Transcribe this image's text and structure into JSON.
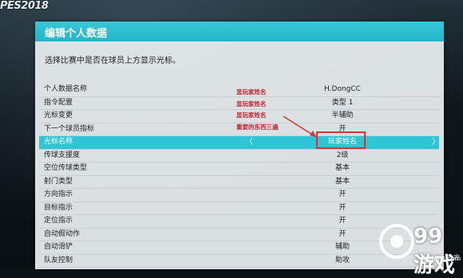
{
  "logo": "PES2018",
  "panel": {
    "title": "编辑个人数据",
    "description": "选择比赛中是否在球员上方显示光标。"
  },
  "rows": [
    {
      "label": "个人数据名称",
      "value": "H.DongCC"
    },
    {
      "label": "指令配置",
      "value": "类型 1"
    },
    {
      "label": "光标变更",
      "value": "半辅助"
    },
    {
      "label": "下一个球员指标",
      "value": "开"
    },
    {
      "label": "光标名称",
      "value": "玩家姓名",
      "selected": true
    },
    {
      "label": "传球支援度",
      "value": "2级"
    },
    {
      "label": "空位传球类型",
      "value": "基本"
    },
    {
      "label": "射门类型",
      "value": "基本"
    },
    {
      "label": "方向指示",
      "value": "开"
    },
    {
      "label": "目标指示",
      "value": "开"
    },
    {
      "label": "定位指示",
      "value": "开"
    },
    {
      "label": "自动假动作",
      "value": "开"
    },
    {
      "label": "自动滑铲",
      "value": "辅助"
    },
    {
      "label": "队友控制",
      "value": "助攻"
    }
  ],
  "hints": [
    "显玩家姓名",
    "显玩家姓名",
    "显玩家姓名",
    "重要的东西三遍"
  ],
  "arrows": {
    "left": "〈",
    "right": "〉"
  },
  "footer_right": "助攻",
  "watermark": {
    "logo": "99游戏",
    "url": "99danji.com"
  },
  "colors": {
    "accent": "#2fc4d6",
    "highlight_box": "#d8332f",
    "hint_text": "#c0272d"
  }
}
